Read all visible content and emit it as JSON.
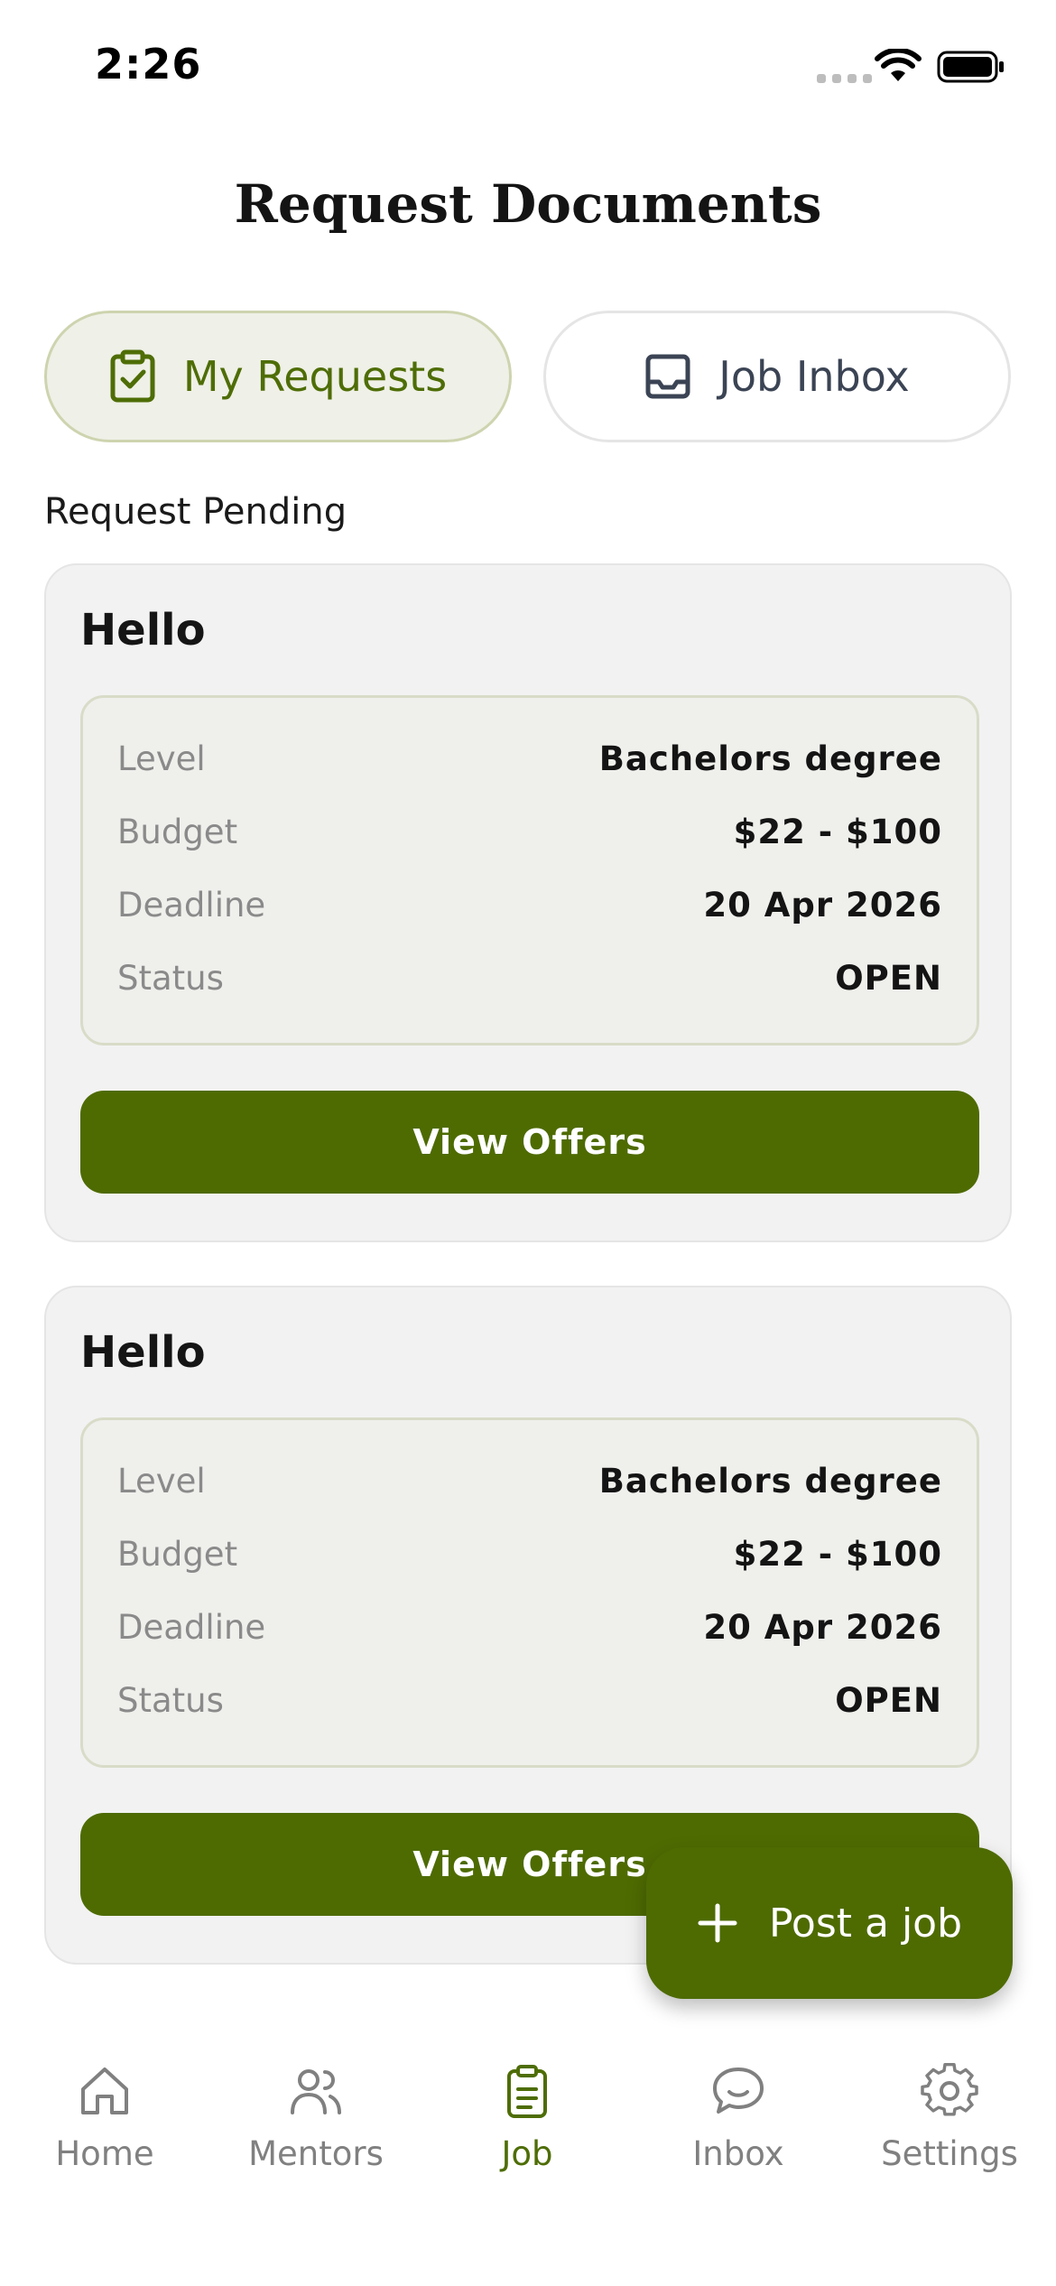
{
  "status_bar": {
    "time": "2:26"
  },
  "page": {
    "title": "Request Documents"
  },
  "tabs": [
    {
      "label": "My Requests",
      "icon": "clipboard-check-icon",
      "active": true
    },
    {
      "label": "Job Inbox",
      "icon": "inbox-tray-icon",
      "active": false
    }
  ],
  "section": {
    "label": "Request Pending"
  },
  "requests": [
    {
      "title": "Hello",
      "fields": [
        {
          "key": "Level",
          "value": "Bachelors degree"
        },
        {
          "key": "Budget",
          "value": "$22 - $100"
        },
        {
          "key": "Deadline",
          "value": "20 Apr 2026"
        },
        {
          "key": "Status",
          "value": "OPEN"
        }
      ],
      "button_label": "View Offers"
    },
    {
      "title": "Hello",
      "fields": [
        {
          "key": "Level",
          "value": "Bachelors degree"
        },
        {
          "key": "Budget",
          "value": "$22 - $100"
        },
        {
          "key": "Deadline",
          "value": "20 Apr 2026"
        },
        {
          "key": "Status",
          "value": "OPEN"
        }
      ],
      "button_label": "View Offers"
    }
  ],
  "fab": {
    "label": "Post a job",
    "icon": "plus-icon"
  },
  "tabbar": [
    {
      "label": "Home",
      "icon": "home-icon",
      "active": false
    },
    {
      "label": "Mentors",
      "icon": "users-icon",
      "active": false
    },
    {
      "label": "Job",
      "icon": "clipboard-icon",
      "active": true
    },
    {
      "label": "Inbox",
      "icon": "chat-bubble-icon",
      "active": false
    },
    {
      "label": "Settings",
      "icon": "gear-icon",
      "active": false
    }
  ],
  "colors": {
    "accent": "#4e6b02",
    "accent_text": "#4e6d06",
    "tab_active_bg": "#eff0e7"
  }
}
